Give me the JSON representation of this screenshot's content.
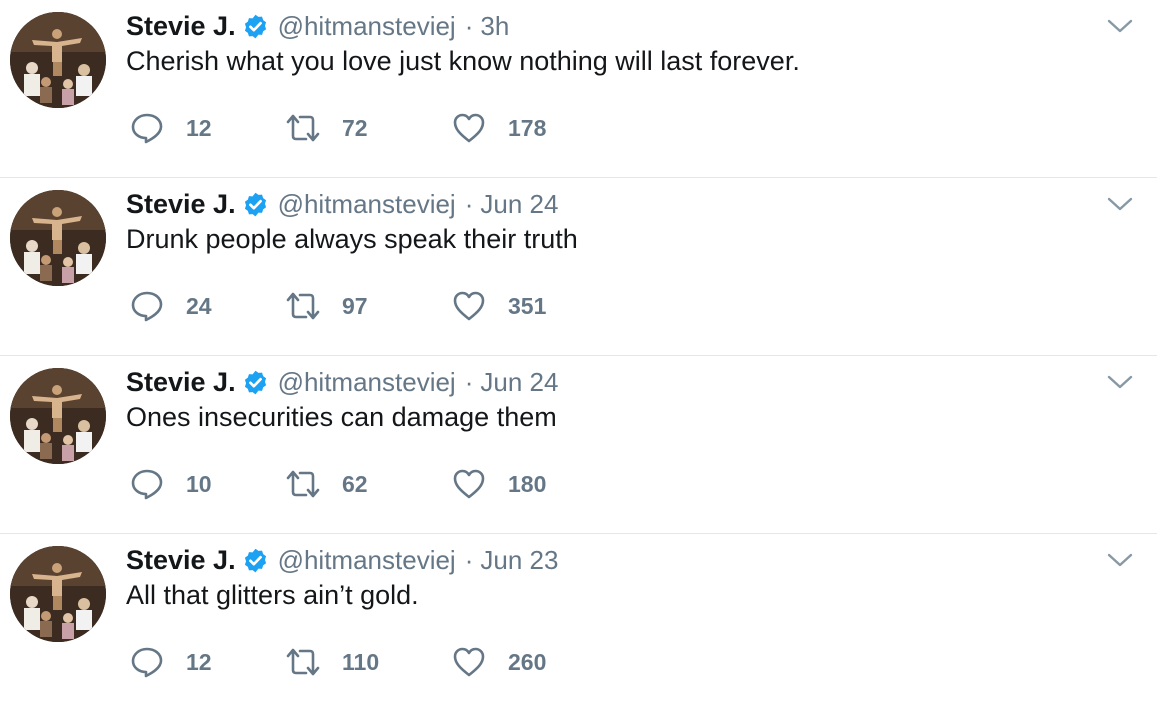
{
  "tweets": [
    {
      "display_name": "Stevie J.",
      "handle": "@hitmansteviej",
      "separator": "·",
      "time": "3h",
      "text": "Cherish what you love just know nothing will last forever.",
      "replies": "12",
      "retweets": "72",
      "likes": "178"
    },
    {
      "display_name": "Stevie J.",
      "handle": "@hitmansteviej",
      "separator": "·",
      "time": "Jun 24",
      "text": "Drunk people always speak their truth",
      "replies": "24",
      "retweets": "97",
      "likes": "351"
    },
    {
      "display_name": "Stevie J.",
      "handle": "@hitmansteviej",
      "separator": "·",
      "time": "Jun 24",
      "text": "Ones insecurities can damage them",
      "replies": "10",
      "retweets": "62",
      "likes": "180"
    },
    {
      "display_name": "Stevie J.",
      "handle": "@hitmansteviej",
      "separator": "·",
      "time": "Jun 23",
      "text": "All that glitters ain’t gold.",
      "replies": "12",
      "retweets": "110",
      "likes": "260"
    }
  ],
  "icons": {
    "verified": "verified-badge-icon",
    "reply": "reply-bubble-icon",
    "retweet": "retweet-arrows-icon",
    "like": "heart-outline-icon",
    "caret": "chevron-down-icon"
  },
  "colors": {
    "verified_blue": "#1da1f2",
    "secondary_text": "#657786",
    "primary_text": "#14171a",
    "divider": "#e1e8ed"
  }
}
